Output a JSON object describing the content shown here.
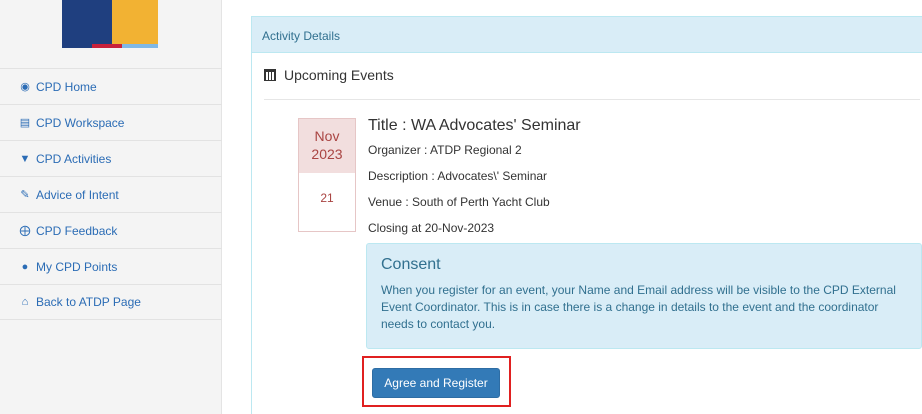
{
  "sidebar": {
    "items": [
      {
        "label": "CPD Home",
        "icon": "dashboard-icon"
      },
      {
        "label": "CPD Workspace",
        "icon": "book-icon"
      },
      {
        "label": "CPD Activities",
        "icon": "trophy-icon"
      },
      {
        "label": "Advice of Intent",
        "icon": "edit-icon"
      },
      {
        "label": "CPD Feedback",
        "icon": "lifebuoy-icon"
      },
      {
        "label": "My CPD Points",
        "icon": "user-icon"
      },
      {
        "label": "Back to ATDP Page",
        "icon": "home-icon"
      }
    ]
  },
  "panel": {
    "heading": "Activity Details",
    "section_title": "Upcoming Events"
  },
  "event": {
    "month": "Nov",
    "year": "2023",
    "day": "21",
    "title": "Title : WA Advocates' Seminar",
    "organizer": "Organizer : ATDP Regional 2",
    "description": "Description : Advocates\\' Seminar",
    "venue": "Venue : South of Perth Yacht Club",
    "closing": "Closing at 20-Nov-2023"
  },
  "consent": {
    "title": "Consent",
    "text": "When you register for an event, your Name and Email address will be visible to the CPD External Event Coordinator. This is in case there is a change in details to the event and the coordinator needs to contact you."
  },
  "actions": {
    "register_label": "Agree and Register"
  },
  "colors": {
    "accent": "#337ab7",
    "info_bg": "#d9edf7",
    "date_bg": "#f2dede",
    "highlight": "#e02020"
  }
}
